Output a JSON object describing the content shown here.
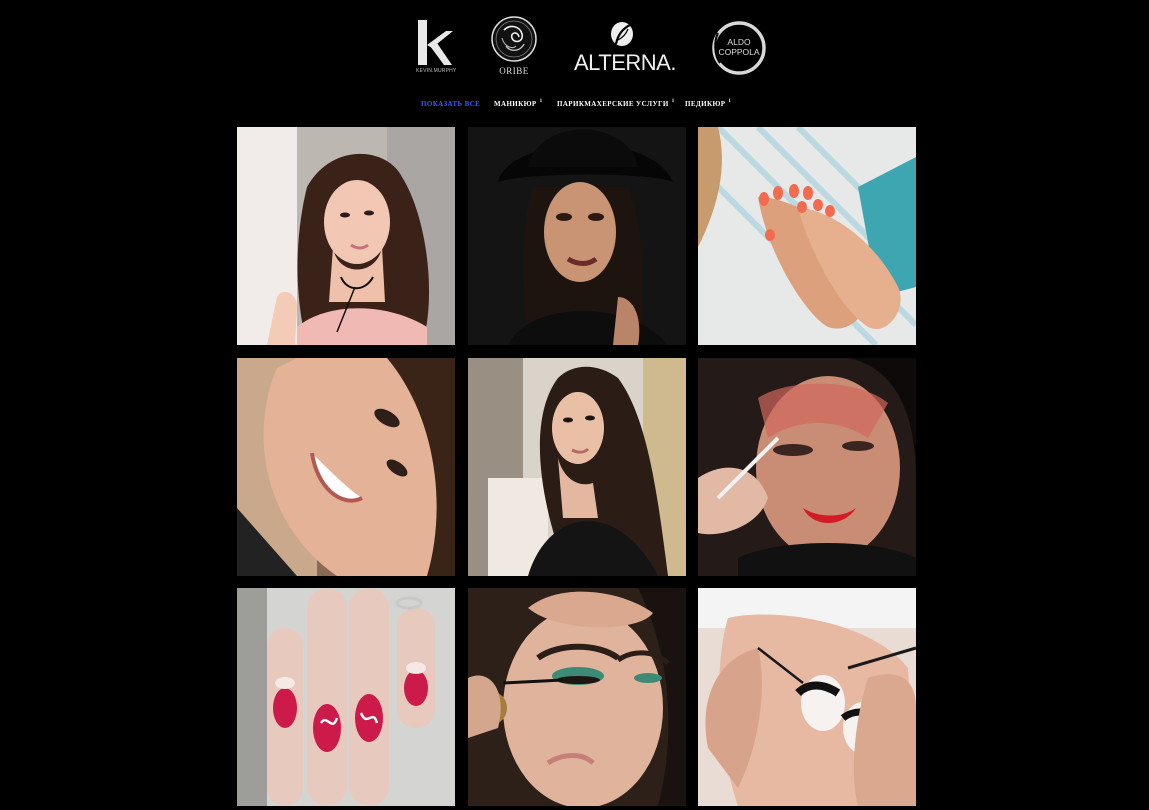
{
  "brands": [
    {
      "name": "kevin-murphy",
      "mark": "k",
      "caption": "KEVIN.MURPHY",
      "icon": "kevin-murphy-logo"
    },
    {
      "name": "oribe",
      "caption": "ORIBE",
      "icon": "oribe-seal-logo"
    },
    {
      "name": "alterna",
      "caption": "ALTERNA.",
      "icon": "alterna-leaf-logo"
    },
    {
      "name": "aldo-coppola",
      "caption_line1": "ALDO",
      "caption_line2": "COPPOLA",
      "icon": "aldo-coppola-ring-logo"
    }
  ],
  "filters": {
    "active": "all",
    "items": [
      {
        "id": "all",
        "label": "ПОКАЗАТЬ ВСЕ",
        "count": ""
      },
      {
        "id": "manicure",
        "label": "МАНИКЮР",
        "count": "1"
      },
      {
        "id": "hair",
        "label": "ПАРИКМАХЕРСКИЕ УСЛУГИ",
        "count": "1"
      },
      {
        "id": "pedicure",
        "label": "ПЕДИКЮР",
        "count": "1"
      }
    ]
  },
  "accent_color": "#3a5bff",
  "gallery": [
    {
      "subject": "woman-with-choker-portrait",
      "background": "#cfc9c4"
    },
    {
      "subject": "woman-in-black-hat-portrait",
      "background": "#151515"
    },
    {
      "subject": "coral-nails-on-towel",
      "background": "#e9ecec"
    },
    {
      "subject": "smiling-woman-closeup",
      "background": "#b79a82"
    },
    {
      "subject": "woman-over-shoulder-portrait",
      "background": "#ddd6cc"
    },
    {
      "subject": "eyeshadow-application",
      "background": "#2a1e1c"
    },
    {
      "subject": "red-nails-love-art",
      "background": "#d8d8d8"
    },
    {
      "subject": "green-eye-makeup-application",
      "background": "#3b2a24"
    },
    {
      "subject": "lash-extension-procedure",
      "background": "#e2d4cc"
    }
  ]
}
